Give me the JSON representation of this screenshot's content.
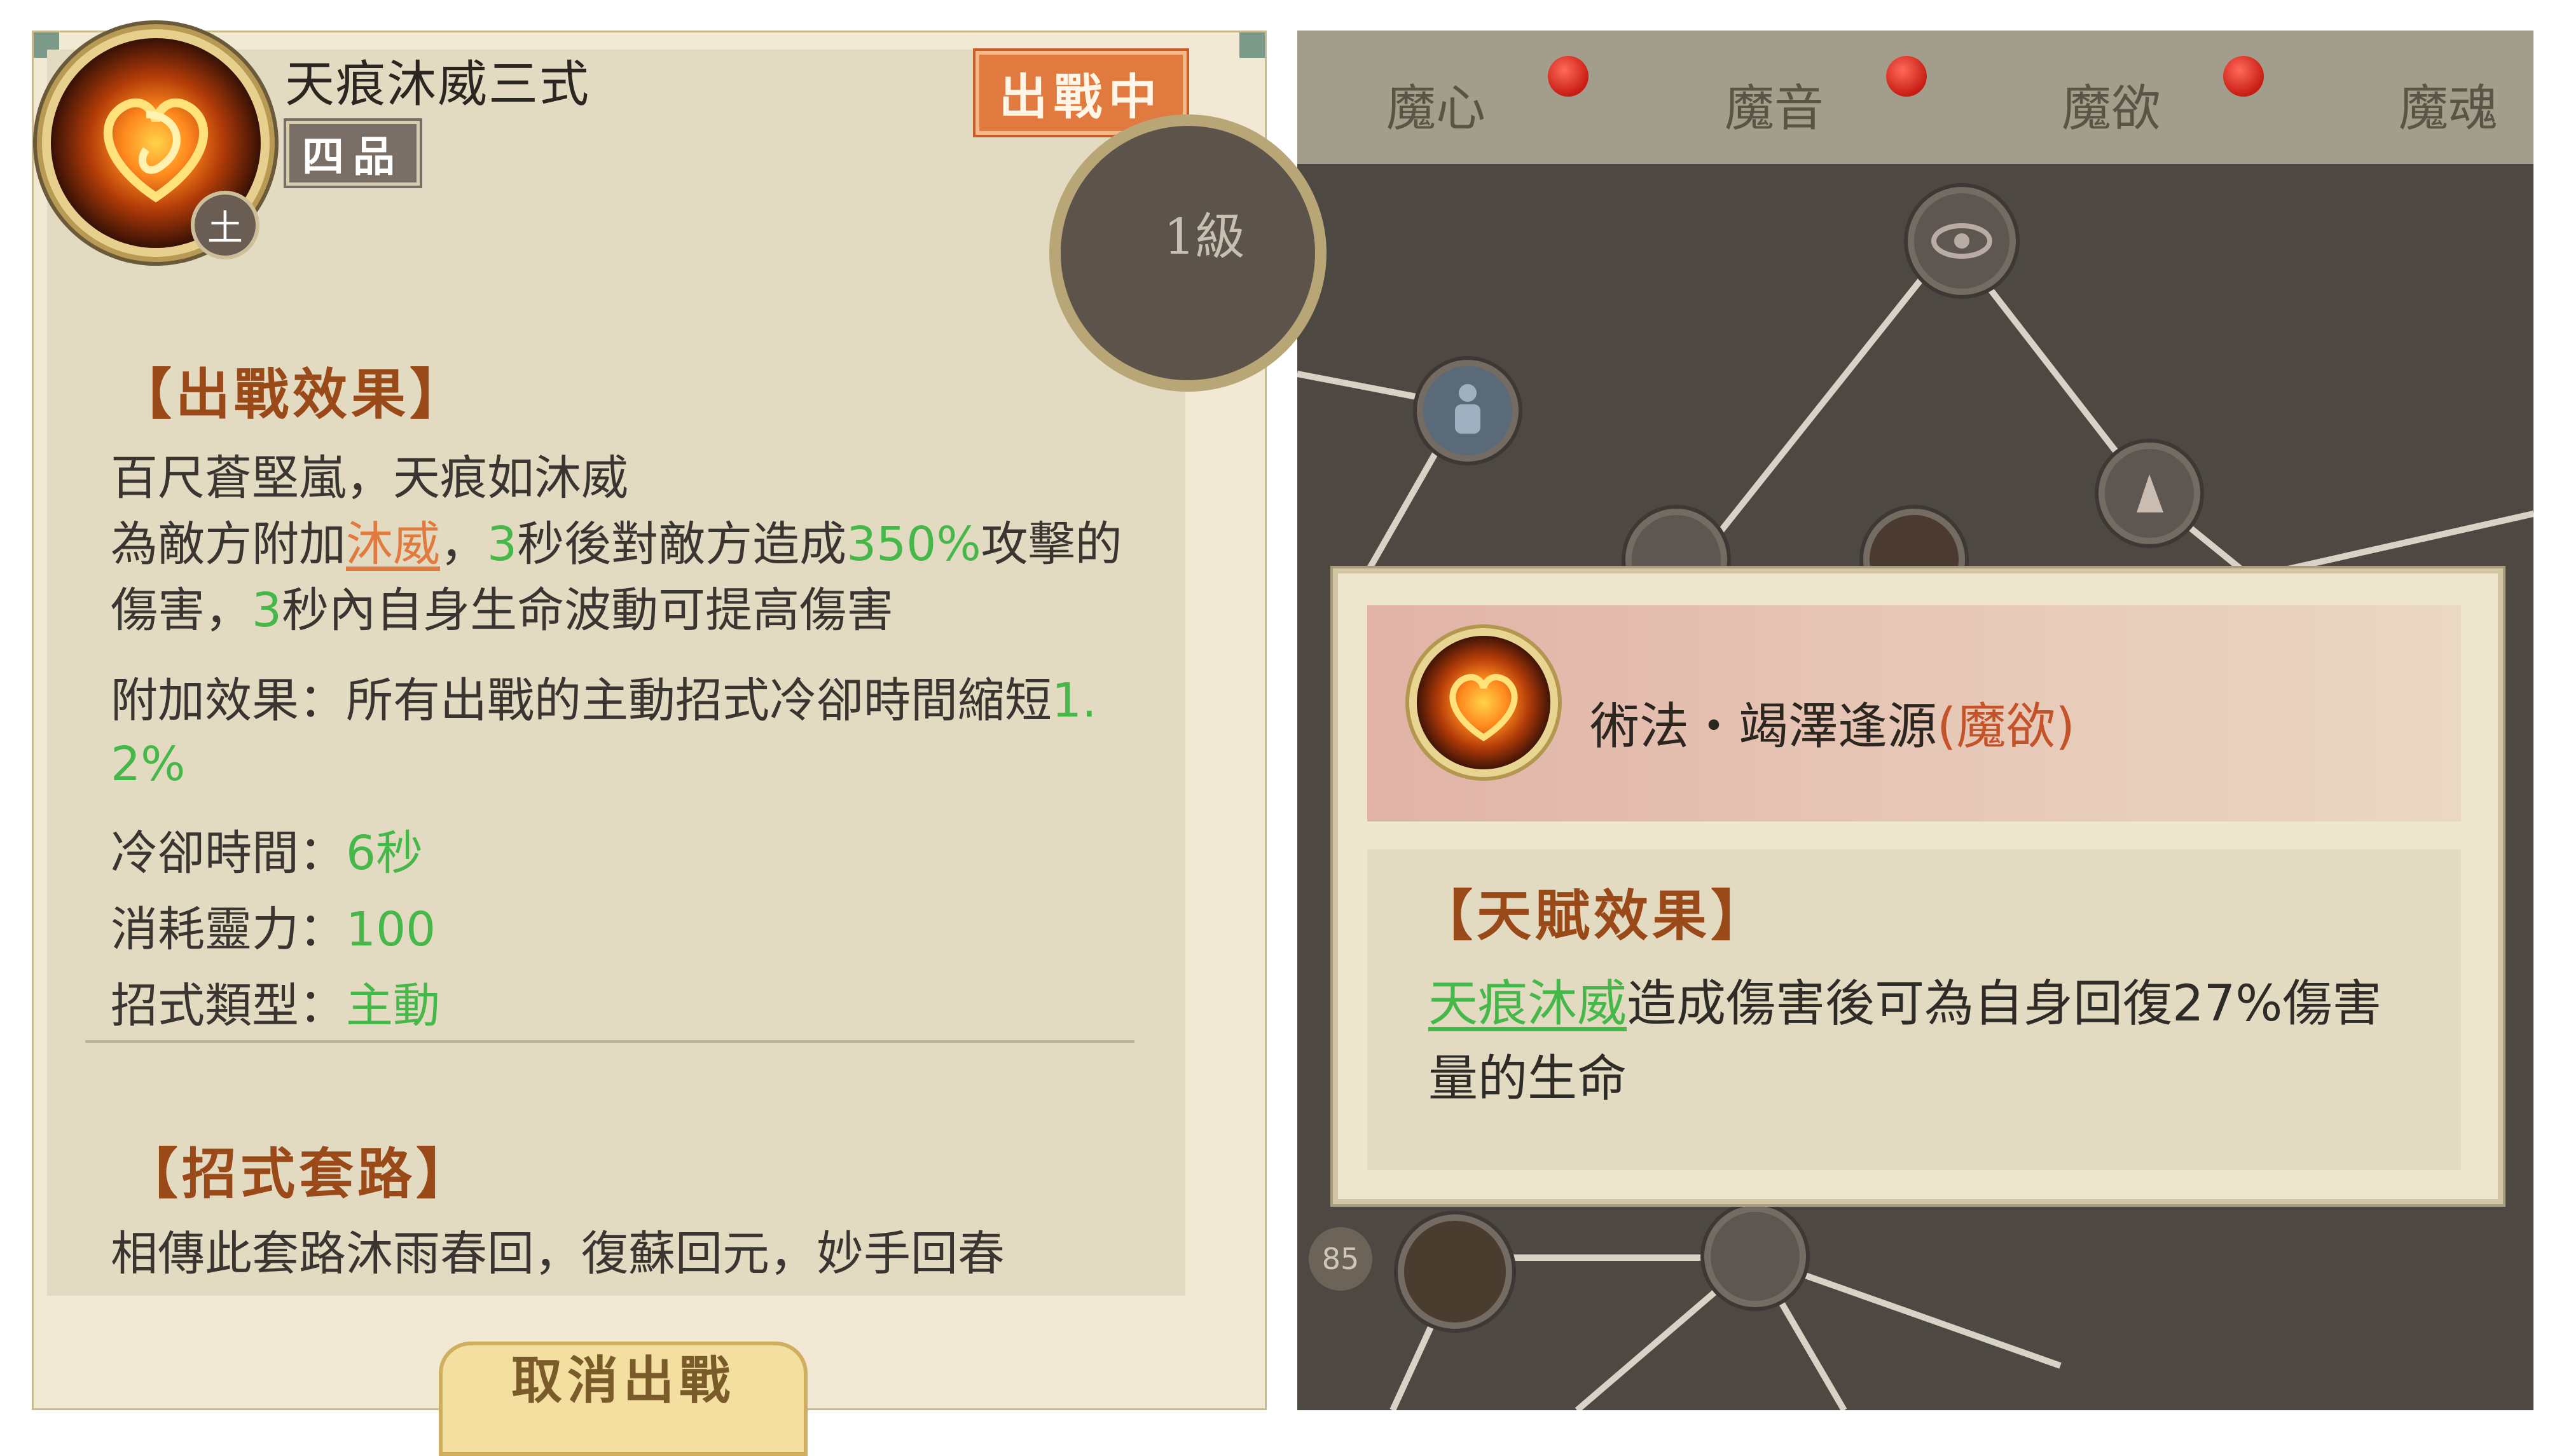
{
  "left_panel": {
    "skill_name": "天痕沐威三式",
    "element_badge": "土",
    "grade": "四品",
    "status_badge": "出戰中",
    "battle_effect": {
      "title": "【出戰效果】",
      "line1": "百尺蒼堅嵐，天痕如沐威",
      "line2_a": "為敵方附加",
      "line2_link": "沐威",
      "line2_b": "，",
      "line2_c": "3",
      "line2_d": "秒後對敵方造成",
      "line2_e": "350%",
      "line2_f": "攻擊的",
      "line3_a": "傷害，",
      "line3_b": "3",
      "line3_c": "秒內自身生命波動可提高傷害",
      "extra_label": "附加效果：所有出戰的主動招式冷卻時間縮短",
      "extra_value_part1": "1.",
      "extra_value_part2": "2%",
      "cooldown_label": "冷卻時間：",
      "cooldown_value": "6秒",
      "cost_label": "消耗靈力：",
      "cost_value": "100",
      "type_label": "招式類型：",
      "type_value": "主動"
    },
    "routine": {
      "title": "【招式套路】",
      "description": "相傳此套路沐雨春回，復蘇回元，妙手回春"
    },
    "cancel_button_label": "取消出戰"
  },
  "right_panel": {
    "tabs": [
      {
        "label": "魔心"
      },
      {
        "label": "魔音"
      },
      {
        "label": "魔欲",
        "active": true
      },
      {
        "label": "魔魂"
      }
    ],
    "level_label": "1級",
    "count_badge": "85",
    "popup": {
      "talent_name": "術法・竭澤逢源",
      "talent_category": "(魔欲)",
      "effect_title": "【天賦效果】",
      "effect_link": "天痕沐威",
      "effect_text_a": "造成傷害後可為自身回復27%傷害",
      "effect_text_b": "量的生命"
    }
  },
  "colors": {
    "panel_bg": "#f1e9d4",
    "section_title": "#9a4a18",
    "highlight_green": "#46b84a",
    "link_orange": "#e07a3e",
    "badge_orange": "#e07a3e",
    "notification_red": "#c81d14"
  },
  "icons": [
    "skill-orb-icon",
    "talent-orb-icon",
    "eye-node-icon",
    "body-node-icon",
    "claw-node-icon"
  ]
}
